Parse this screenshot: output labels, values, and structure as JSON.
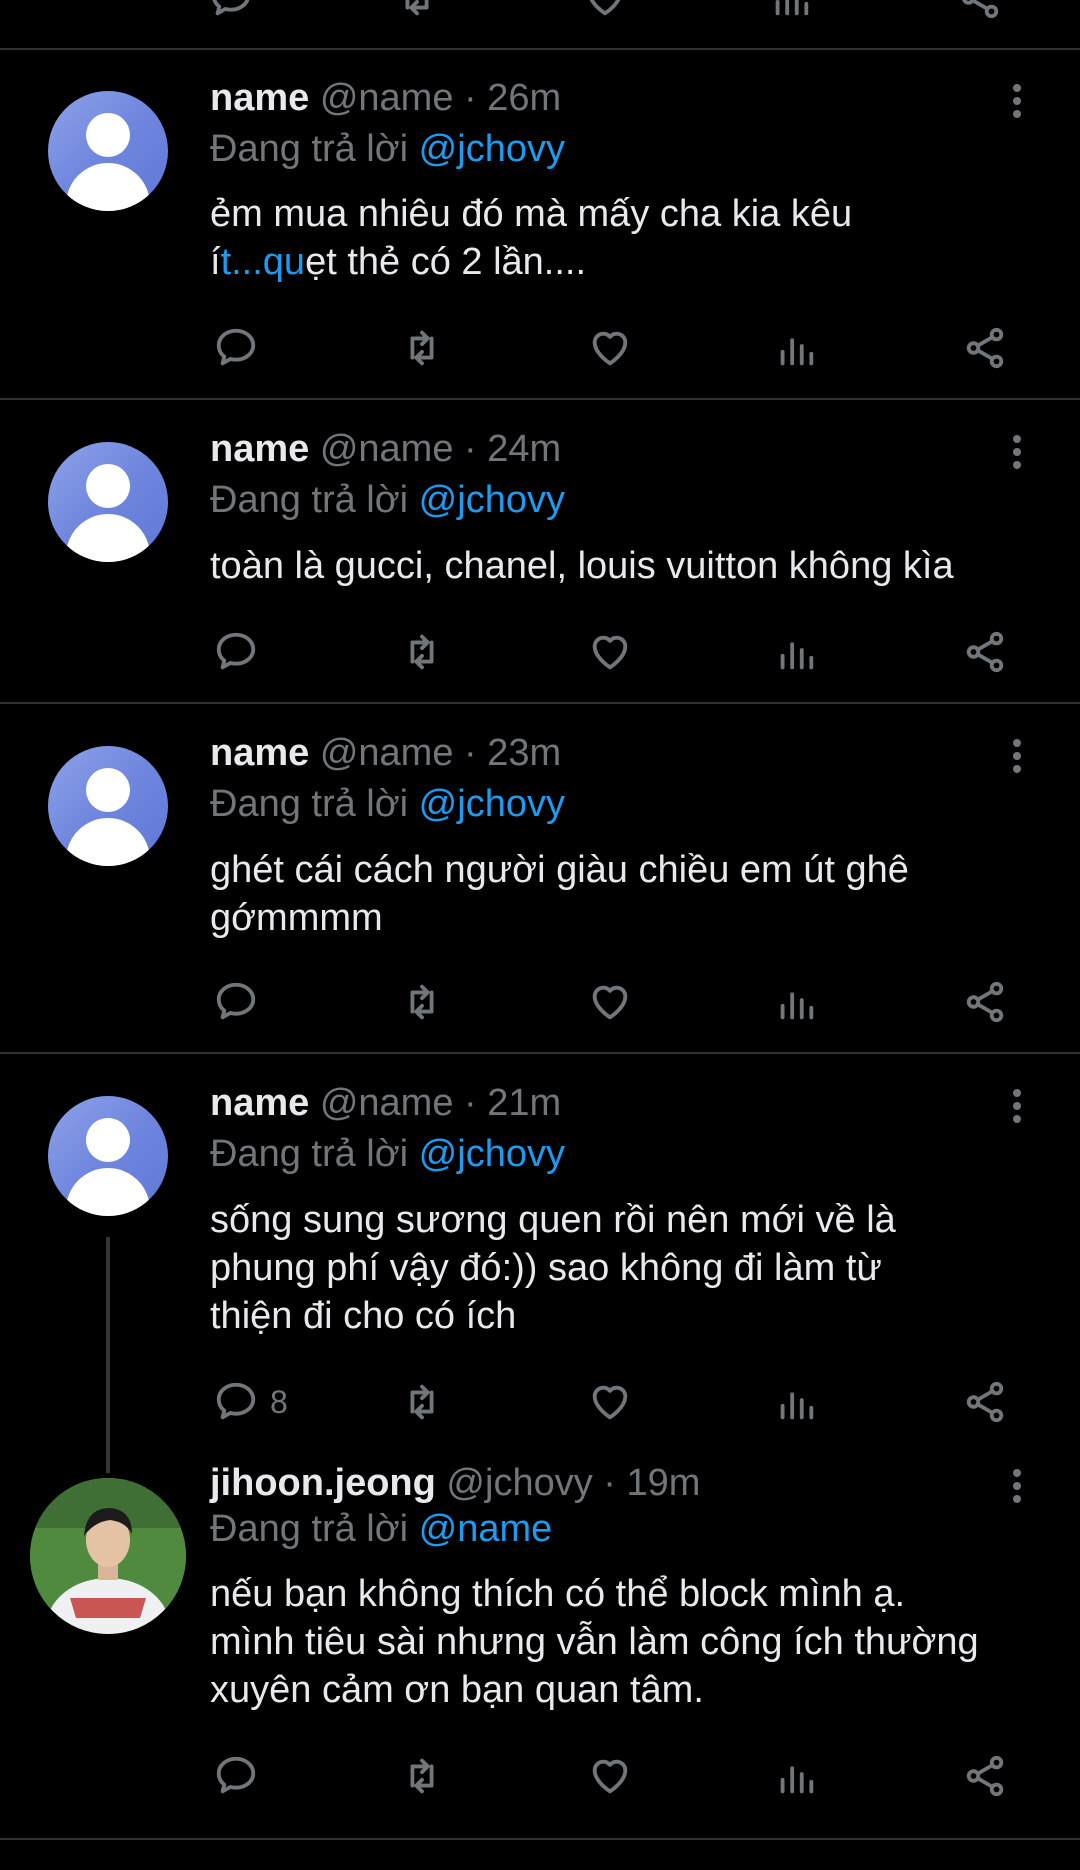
{
  "tweets": [
    {
      "name": "name",
      "handle": "@name",
      "dot": " · ",
      "time": "26m",
      "reply_label": "Đang trả lời ",
      "reply_mention": "@jchovy",
      "text_line1": "ẻm mua nhiêu đó mà mấy cha kia kêu",
      "text_line2_a": "í",
      "text_line2_link1": "t...",
      "text_line2_link2": "qu",
      "text_line2_b": "ẹt thẻ có 2 lần....",
      "reply_count": ""
    },
    {
      "name": "name",
      "handle": "@name",
      "dot": " · ",
      "time": "24m",
      "reply_label": "Đang trả lời ",
      "reply_mention": "@jchovy",
      "text": "toàn là gucci, chanel, louis vuitton không kìa",
      "reply_count": ""
    },
    {
      "name": "name",
      "handle": "@name",
      "dot": " · ",
      "time": "23m",
      "reply_label": "Đang trả lời ",
      "reply_mention": "@jchovy",
      "text": "ghét cái cách người giàu chiều em út ghê gớmmmm",
      "reply_count": ""
    },
    {
      "name": "name",
      "handle": "@name",
      "dot": " · ",
      "time": "21m",
      "reply_label": "Đang trả lời ",
      "reply_mention": "@jchovy",
      "text": "sống sung sương quen rồi nên mới về là phung phí vậy đó:)) sao không đi làm từ thiện đi cho có ích",
      "reply_count": "8"
    },
    {
      "name": "jihoon.jeong",
      "handle": "@jchovy",
      "dot": " · ",
      "time": "19m",
      "reply_label": "Đang trả lời ",
      "reply_mention": "@name",
      "text": "nếu bạn không thích có thể block mình ạ. mình tiêu sài nhưng vẫn làm công ích thường xuyên cảm ơn bạn quan tâm.",
      "reply_count": ""
    }
  ],
  "colors": {
    "background": "#000000",
    "text": "#e7e9ea",
    "muted": "#71767b",
    "accent": "#1d9bf0",
    "divider": "#2f3336"
  },
  "icons": [
    "reply-icon",
    "retweet-icon",
    "like-icon",
    "views-icon",
    "share-icon",
    "more-icon"
  ]
}
